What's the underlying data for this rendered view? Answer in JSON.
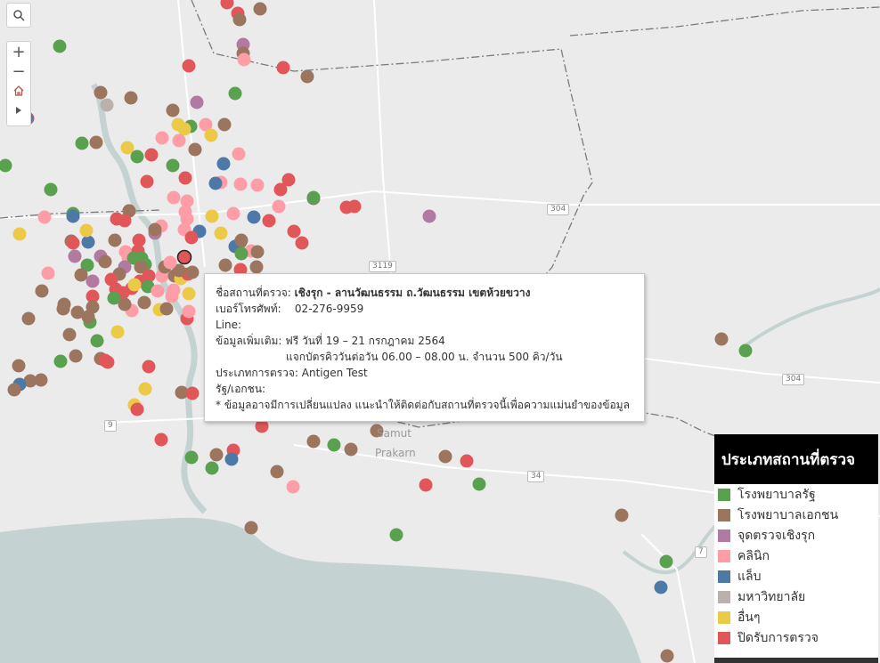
{
  "map": {
    "place_labels": [
      "Samut",
      "Prakarn"
    ],
    "road_labels": [
      "304",
      "3119",
      "304",
      "34",
      "9",
      "7"
    ],
    "category_colors": {
      "gov": "#59a14f",
      "priv": "#9c755f",
      "mobile": "#b07aa1",
      "clinic": "#ff9da7",
      "lab": "#4e79a7",
      "uni": "#bab0ac",
      "other": "#edc948",
      "closed": "#e15759"
    }
  },
  "controls": {
    "search_icon": "search-icon",
    "zoom_in": "+",
    "zoom_out": "−",
    "home_icon": "home-icon",
    "expand_icon": "play-icon"
  },
  "tooltip": {
    "name_label": "ชื่อสถานที่ตรวจ:",
    "name_value": "เชิงรุก - ลานวัฒนธรรม ถ.วัฒนธรรม เขตห้วยขวาง",
    "phone_label": "เบอร์โทรศัพท์:",
    "phone_value": "02-276-9959",
    "line_label": "Line:",
    "info_label": "ข้อมูลเพิ่มเติม:",
    "info_value_1": "ฟรี วันที่ 19 – 21 กรกฎาคม 2564",
    "info_value_2": "แจกบัตรคิววันต่อวัน 06.00 – 08.00 น. จำนวน 500 คิว/วัน",
    "type_label": "ประเภทการตรวจ:",
    "type_value": "Antigen Test",
    "sector_label": "รัฐ/เอกชน:",
    "note": "* ข้อมูลอาจมีการเปลี่ยนแปลง แนะนำให้ติดต่อกับสถานที่ตรวจนี้เพื่อความแม่นยำของข้อมูล"
  },
  "legend": {
    "title": "ประเภทสถานที่ตรวจ",
    "items": [
      {
        "label": "โรงพยาบาลรัฐ",
        "color": "#59a14f"
      },
      {
        "label": "โรงพยาบาลเอกชน",
        "color": "#9c755f"
      },
      {
        "label": "จุดตรวจเชิงรุก",
        "color": "#b07aa1"
      },
      {
        "label": "คลินิก",
        "color": "#ff9da7"
      },
      {
        "label": "แล็บ",
        "color": "#4e79a7"
      },
      {
        "label": "มหาวิทยาลัย",
        "color": "#bab0ac"
      },
      {
        "label": "อื่นๆ",
        "color": "#edc948"
      },
      {
        "label": "ปิดรับการตรวจ",
        "color": "#e15759"
      }
    ]
  }
}
